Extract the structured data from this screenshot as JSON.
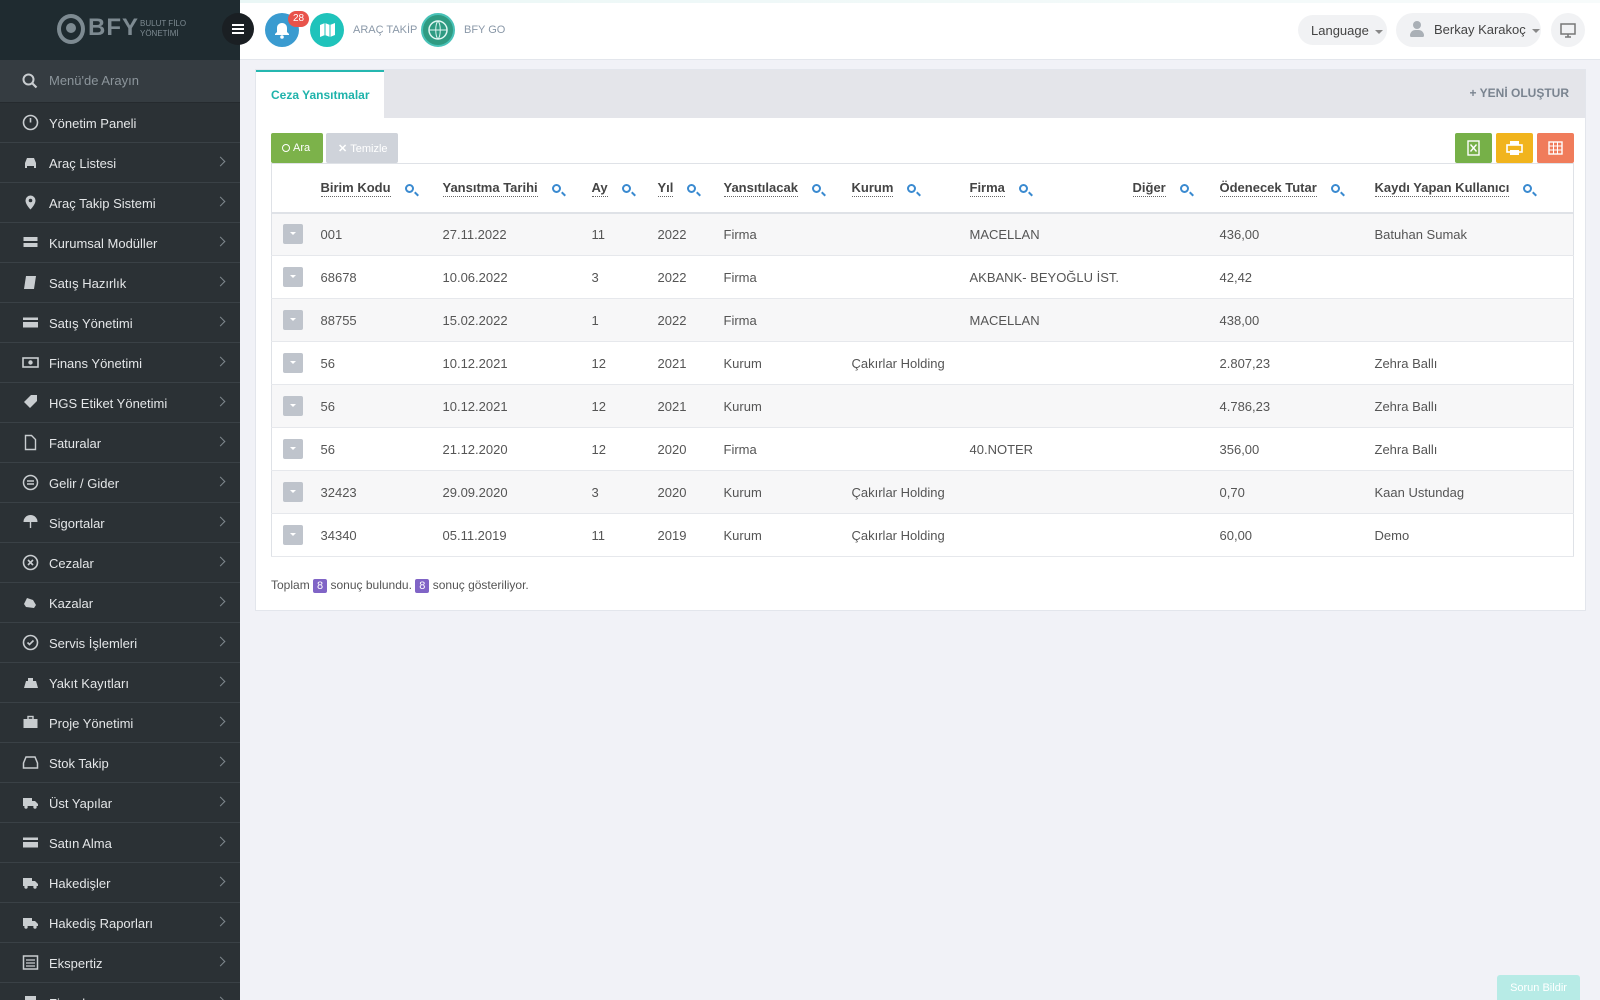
{
  "app": {
    "logo_text": "BFY",
    "logo_sub": "BULUT FİLO YÖNETİMİ"
  },
  "topbar": {
    "notification_count": "28",
    "arac_takip_label": "ARAÇ TAKİP",
    "bfy_go_label": "BFY GO",
    "language_label": "Language",
    "user_name": "Berkay Karakoç"
  },
  "sidebar": {
    "search_placeholder": "Menü'de Arayın",
    "items": [
      {
        "label": "Yönetim Paneli",
        "icon": "dashboard-icon",
        "chevron": false
      },
      {
        "label": "Araç Listesi",
        "icon": "car-icon",
        "chevron": true
      },
      {
        "label": "Araç Takip Sistemi",
        "icon": "map-marker-icon",
        "chevron": true
      },
      {
        "label": "Kurumsal Modüller",
        "icon": "server-icon",
        "chevron": true
      },
      {
        "label": "Satış Hazırlık",
        "icon": "book-icon",
        "chevron": true
      },
      {
        "label": "Satış Yönetimi",
        "icon": "credit-card-icon",
        "chevron": true
      },
      {
        "label": "Finans Yönetimi",
        "icon": "money-icon",
        "chevron": true
      },
      {
        "label": "HGS Etiket Yönetimi",
        "icon": "tag-icon",
        "chevron": true
      },
      {
        "label": "Faturalar",
        "icon": "file-icon",
        "chevron": true
      },
      {
        "label": "Gelir / Gider",
        "icon": "exchange-icon",
        "chevron": true
      },
      {
        "label": "Sigortalar",
        "icon": "umbrella-icon",
        "chevron": true
      },
      {
        "label": "Cezalar",
        "icon": "times-circle-icon",
        "chevron": true
      },
      {
        "label": "Kazalar",
        "icon": "car-crash-icon",
        "chevron": true
      },
      {
        "label": "Servis İşlemleri",
        "icon": "check-circle-icon",
        "chevron": true
      },
      {
        "label": "Yakıt Kayıtları",
        "icon": "fuel-icon",
        "chevron": true
      },
      {
        "label": "Proje Yönetimi",
        "icon": "briefcase-icon",
        "chevron": true
      },
      {
        "label": "Stok Takip",
        "icon": "inbox-icon",
        "chevron": true
      },
      {
        "label": "Üst Yapılar",
        "icon": "truck-icon",
        "chevron": true
      },
      {
        "label": "Satın Alma",
        "icon": "credit-card-icon",
        "chevron": true
      },
      {
        "label": "Hakedişler",
        "icon": "truck-icon",
        "chevron": true
      },
      {
        "label": "Hakediş Raporları",
        "icon": "truck-icon",
        "chevron": true
      },
      {
        "label": "Ekspertiz",
        "icon": "list-alt-icon",
        "chevron": true
      },
      {
        "label": "Firmalar",
        "icon": "building-icon",
        "chevron": true
      }
    ]
  },
  "panel": {
    "tab_label": "Ceza Yansıtmalar",
    "new_button_label": "+ YENİ OLUŞTUR",
    "search_button_label": "Ara",
    "clear_button_label": "Temizle"
  },
  "table": {
    "columns": [
      "Birim Kodu",
      "Yansıtma Tarihi",
      "Ay",
      "Yıl",
      "Yansıtılacak",
      "Kurum",
      "Firma",
      "Diğer",
      "Ödenecek Tutar",
      "Kaydı Yapan Kullanıcı"
    ],
    "rows": [
      [
        "001",
        "27.11.2022",
        "11",
        "2022",
        "Firma",
        "",
        "MACELLAN",
        "",
        "436,00",
        "Batuhan Sumak"
      ],
      [
        "68678",
        "10.06.2022",
        "3",
        "2022",
        "Firma",
        "",
        "AKBANK- BEYOĞLU İST.",
        "",
        "42,42",
        ""
      ],
      [
        "88755",
        "15.02.2022",
        "1",
        "2022",
        "Firma",
        "",
        "MACELLAN",
        "",
        "438,00",
        ""
      ],
      [
        "56",
        "10.12.2021",
        "12",
        "2021",
        "Kurum",
        "Çakırlar Holding",
        "",
        "",
        "2.807,23",
        "Zehra Ballı"
      ],
      [
        "56",
        "10.12.2021",
        "12",
        "2021",
        "Kurum",
        "",
        "",
        "",
        "4.786,23",
        "Zehra Ballı"
      ],
      [
        "56",
        "21.12.2020",
        "12",
        "2020",
        "Firma",
        "",
        "40.NOTER",
        "",
        "356,00",
        "Zehra Ballı"
      ],
      [
        "32423",
        "29.09.2020",
        "3",
        "2020",
        "Kurum",
        "Çakırlar Holding",
        "",
        "",
        "0,70",
        "Kaan Ustundag"
      ],
      [
        "34340",
        "05.11.2019",
        "11",
        "2019",
        "Kurum",
        "Çakırlar Holding",
        "",
        "",
        "60,00",
        "Demo"
      ]
    ]
  },
  "summary": {
    "prefix": "Toplam",
    "total": "8",
    "found_text": "sonuç bulundu.",
    "shown": "8",
    "shown_text": "sonuç gösteriliyor."
  },
  "report_button_label": "Sorun Bildir"
}
